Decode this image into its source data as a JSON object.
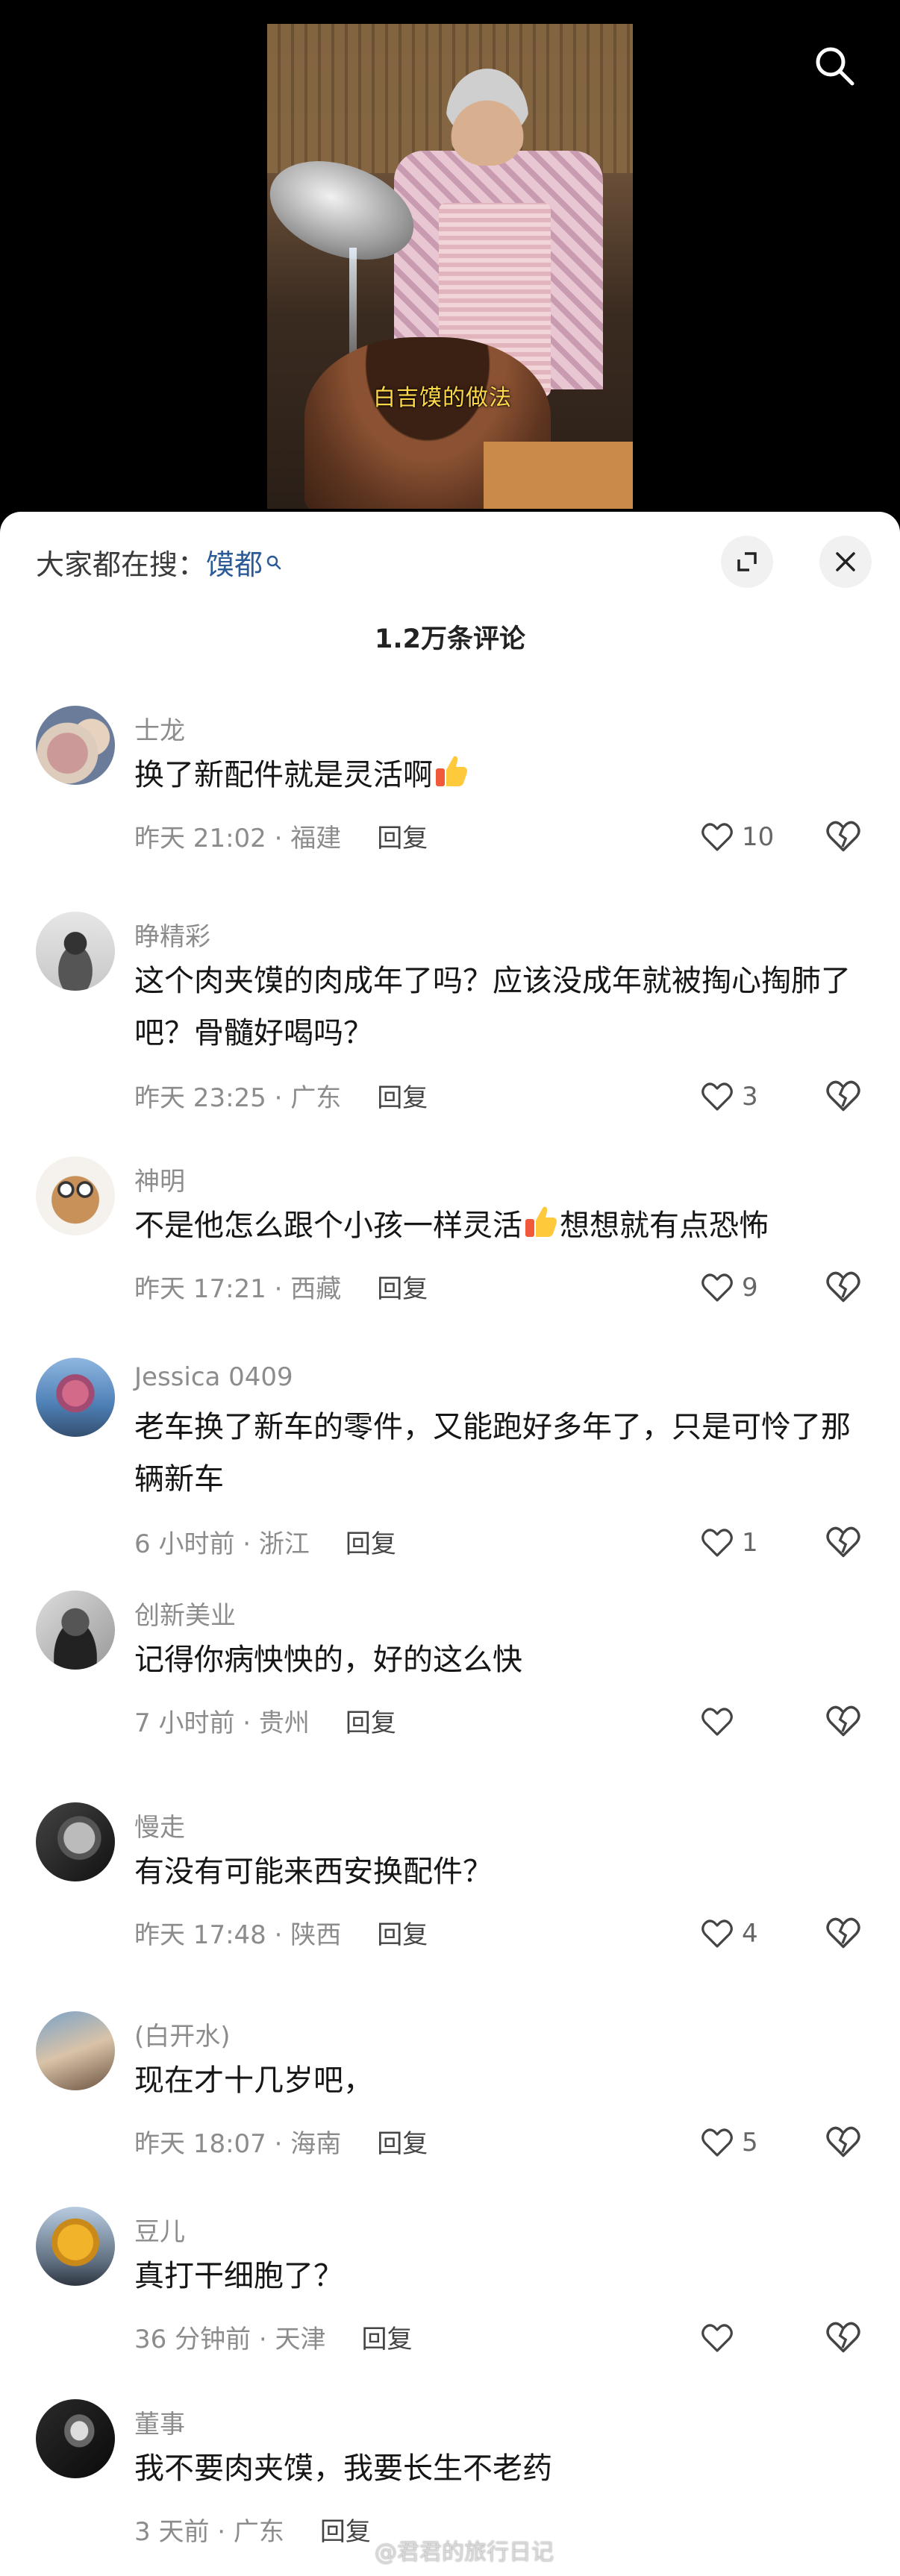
{
  "video": {
    "caption": "白吉馍的做法"
  },
  "sheet": {
    "search_prefix": "大家都在搜：",
    "search_keyword": "馍都",
    "comment_count": "1.2万条评论"
  },
  "comments": [
    {
      "name": "士龙",
      "text": "换了新配件就是灵活啊",
      "emoji": "thumbs-up",
      "time": "昨天 21:02 · 福建",
      "reply": "回复",
      "likes": "10"
    },
    {
      "name": "睁精彩",
      "text": "这个肉夹馍的肉成年了吗？应该没成年就被掏心掏肺了吧？骨髓好喝吗？",
      "time": "昨天 23:25 · 广东",
      "reply": "回复",
      "likes": "3"
    },
    {
      "name": "神明",
      "text_before": "不是他怎么跟个小孩一样灵活",
      "emoji": "thumbs-up",
      "text_after": "想想就有点恐怖",
      "time": "昨天 17:21 · 西藏",
      "reply": "回复",
      "likes": "9"
    },
    {
      "name": "Jessica 0409",
      "text": "老车换了新车的零件，又能跑好多年了，只是可怜了那辆新车",
      "time": "6 小时前 · 浙江",
      "reply": "回复",
      "likes": "1"
    },
    {
      "name": "创新美业",
      "text": "记得你病怏怏的，好的这么快",
      "time": "7 小时前 · 贵州",
      "reply": "回复",
      "likes": ""
    },
    {
      "name": "慢走",
      "text": "有没有可能来西安换配件？",
      "time": "昨天 17:48 · 陕西",
      "reply": "回复",
      "likes": "4"
    },
    {
      "name": "(白开水)",
      "text": "现在才十几岁吧，",
      "time": "昨天 18:07 · 海南",
      "reply": "回复",
      "likes": "5"
    },
    {
      "name": "豆儿",
      "text": "真打干细胞了？",
      "time": "36 分钟前 · 天津",
      "reply": "回复",
      "likes": ""
    },
    {
      "name": "董事",
      "text": "我不要肉夹馍，我要长生不老药",
      "time": "3 天前 · 广东",
      "reply": "回复",
      "likes": ""
    }
  ],
  "watermark": "@君君的旅行日记",
  "icons": {
    "search": "search-icon",
    "expand": "expand-icon",
    "close": "close-icon",
    "like": "heart-icon",
    "dislike": "broken-heart-icon"
  },
  "colors": {
    "keyword": "#2d5b98",
    "caption": "#ffd84a"
  }
}
